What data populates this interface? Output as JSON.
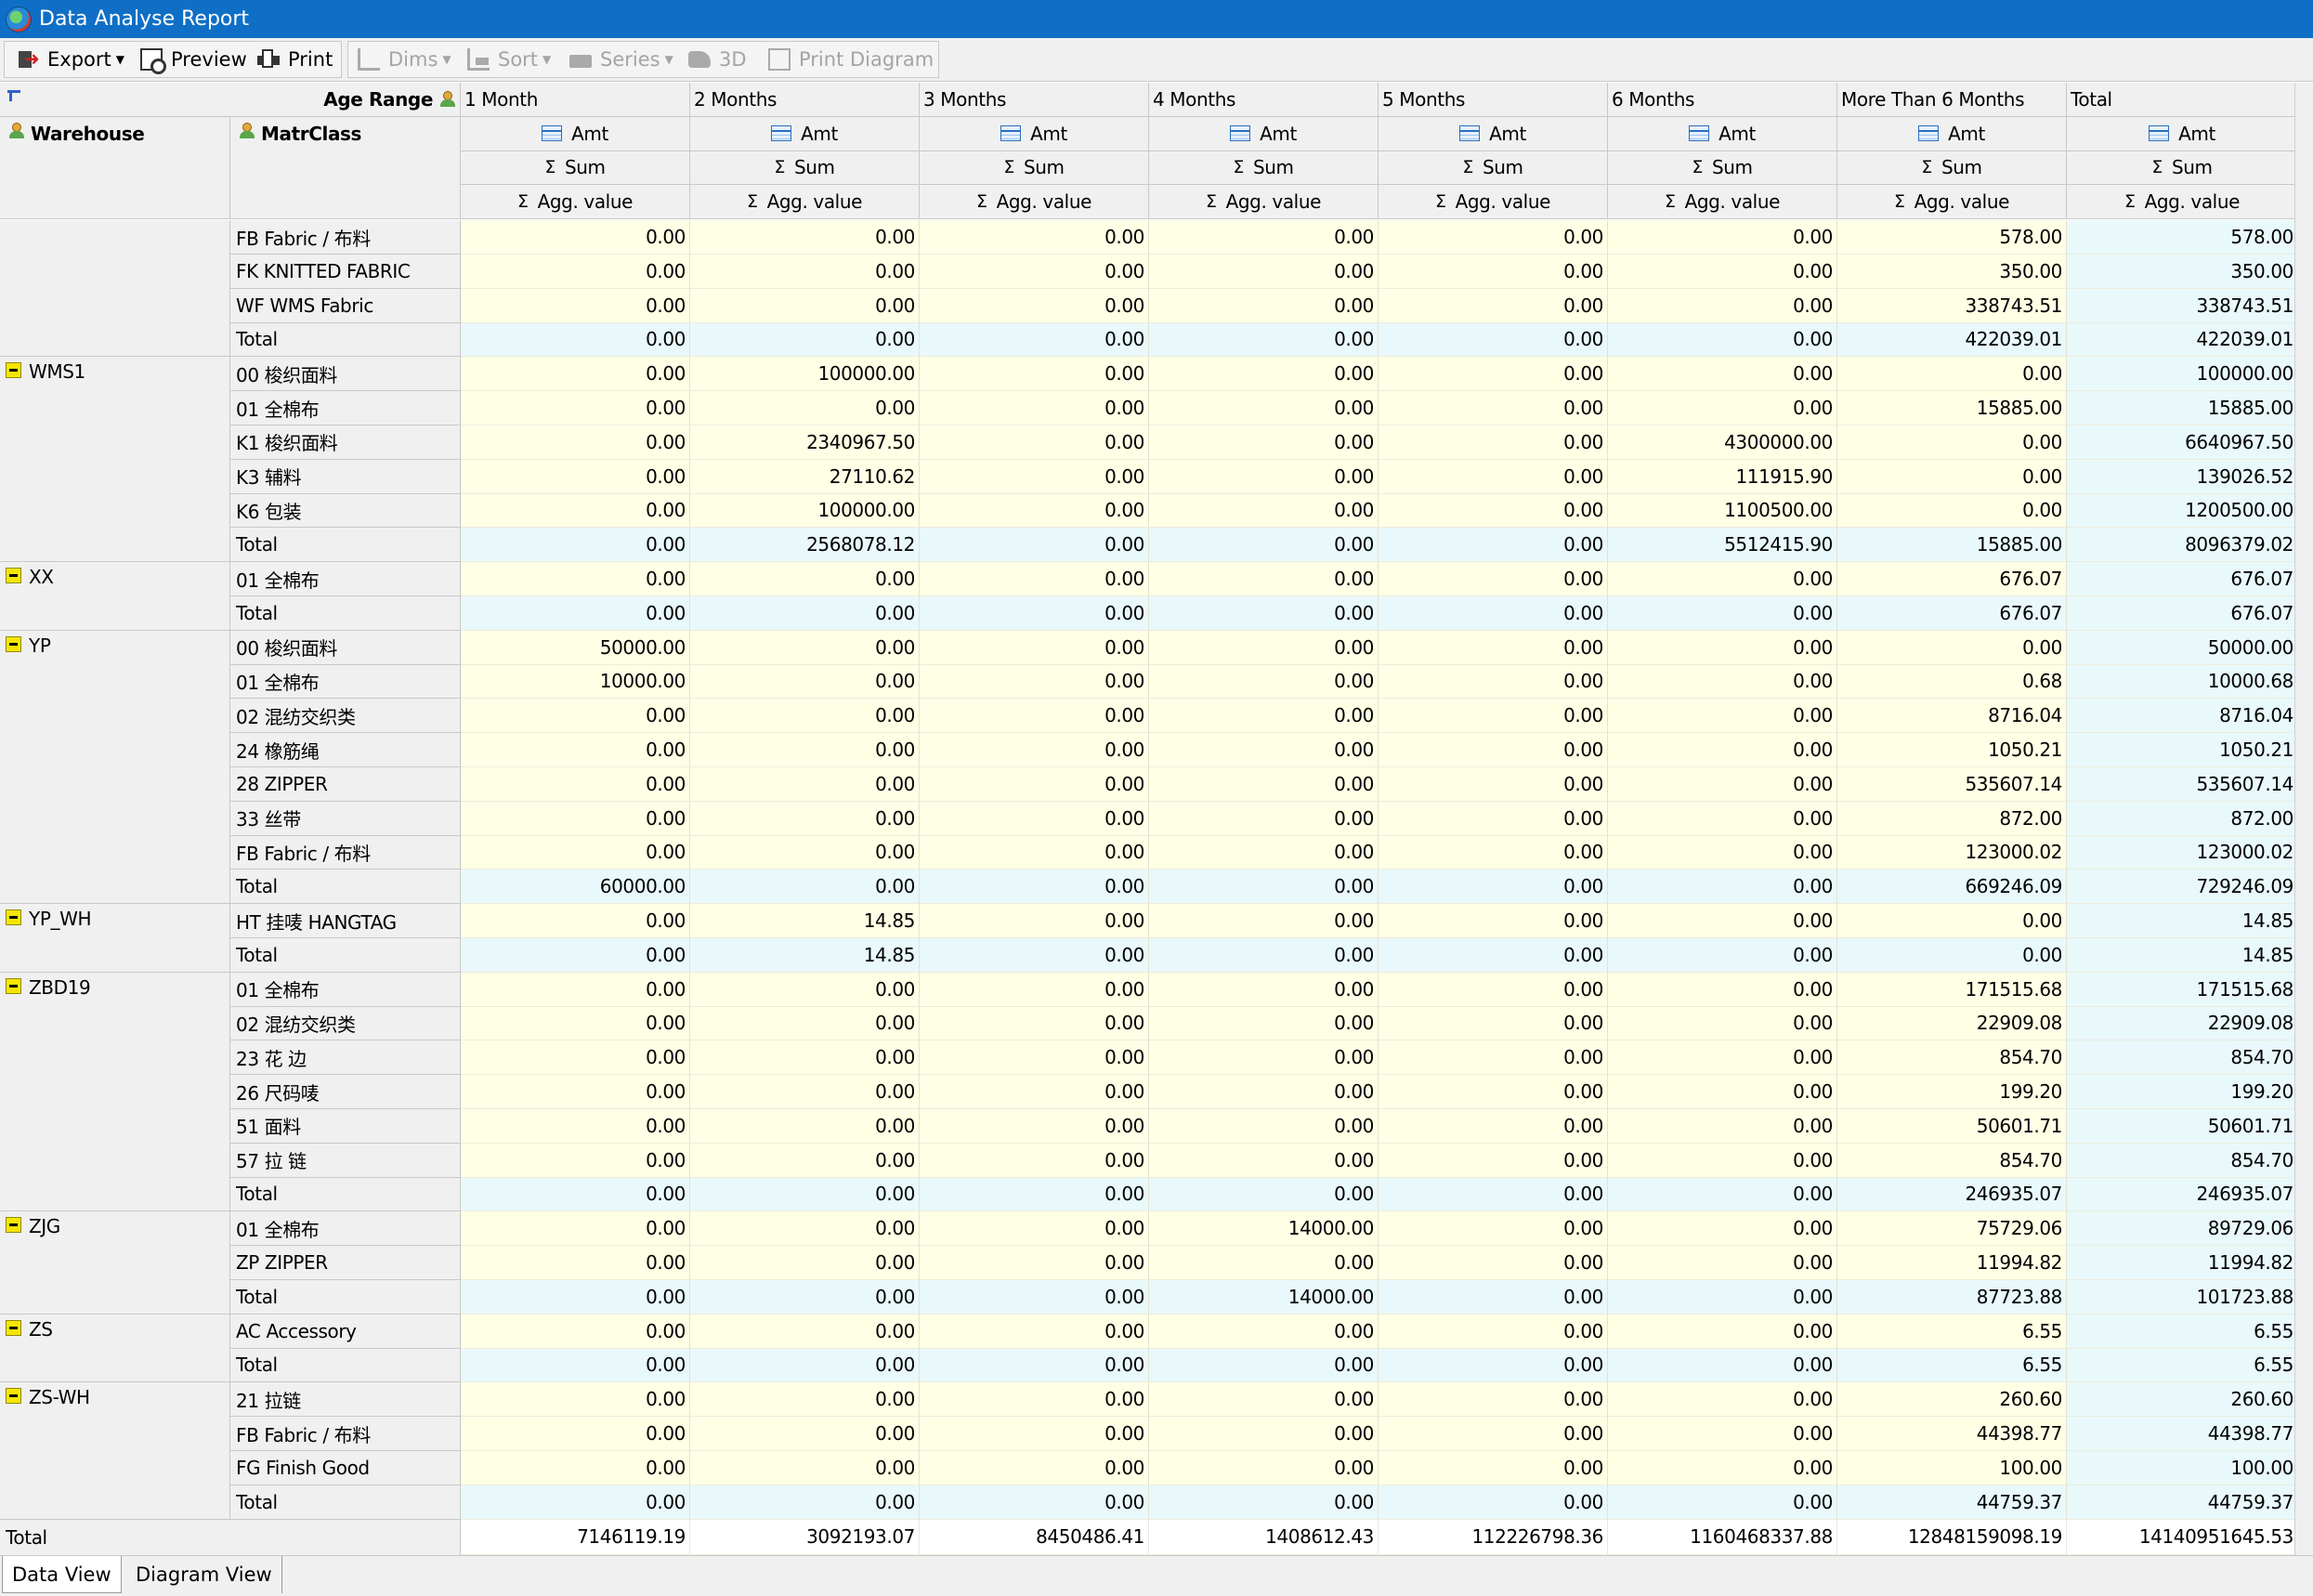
{
  "window": {
    "title": "Data Analyse Report"
  },
  "toolbar": {
    "export": "Export",
    "preview": "Preview",
    "print": "Print",
    "dims": "Dims",
    "sort": "Sort",
    "series": "Series",
    "three_d": "3D",
    "print_diagram": "Print Diagram"
  },
  "pivot": {
    "column_field": "Age Range",
    "row_fields": [
      "Warehouse",
      "MatrClass"
    ],
    "columns": [
      "1 Month",
      "2 Months",
      "3 Months",
      "4 Months",
      "5 Months",
      "6 Months",
      "More Than 6 Months",
      "Total"
    ],
    "measure": "Amt",
    "summary": "Sum",
    "agg_label": "Agg. value",
    "total_label": "Total",
    "groups": [
      {
        "warehouse": "",
        "collapsible": false,
        "rows": [
          {
            "label": "FB  Fabric / 布料",
            "values": [
              "0.00",
              "0.00",
              "0.00",
              "0.00",
              "0.00",
              "0.00",
              "578.00",
              "578.00"
            ]
          },
          {
            "label": "FK  KNITTED FABRIC",
            "values": [
              "0.00",
              "0.00",
              "0.00",
              "0.00",
              "0.00",
              "0.00",
              "350.00",
              "350.00"
            ]
          },
          {
            "label": "WF  WMS Fabric",
            "values": [
              "0.00",
              "0.00",
              "0.00",
              "0.00",
              "0.00",
              "0.00",
              "338743.51",
              "338743.51"
            ]
          },
          {
            "label": "Total",
            "total": true,
            "values": [
              "0.00",
              "0.00",
              "0.00",
              "0.00",
              "0.00",
              "0.00",
              "422039.01",
              "422039.01"
            ]
          }
        ]
      },
      {
        "warehouse": "WMS1",
        "collapsible": true,
        "rows": [
          {
            "label": "00  梭织面料",
            "values": [
              "0.00",
              "100000.00",
              "0.00",
              "0.00",
              "0.00",
              "0.00",
              "0.00",
              "100000.00"
            ]
          },
          {
            "label": "01  全棉布",
            "values": [
              "0.00",
              "0.00",
              "0.00",
              "0.00",
              "0.00",
              "0.00",
              "15885.00",
              "15885.00"
            ]
          },
          {
            "label": "K1  梭织面料",
            "values": [
              "0.00",
              "2340967.50",
              "0.00",
              "0.00",
              "0.00",
              "4300000.00",
              "0.00",
              "6640967.50"
            ]
          },
          {
            "label": "K3  辅料",
            "values": [
              "0.00",
              "27110.62",
              "0.00",
              "0.00",
              "0.00",
              "111915.90",
              "0.00",
              "139026.52"
            ]
          },
          {
            "label": "K6  包装",
            "values": [
              "0.00",
              "100000.00",
              "0.00",
              "0.00",
              "0.00",
              "1100500.00",
              "0.00",
              "1200500.00"
            ]
          },
          {
            "label": "Total",
            "total": true,
            "values": [
              "0.00",
              "2568078.12",
              "0.00",
              "0.00",
              "0.00",
              "5512415.90",
              "15885.00",
              "8096379.02"
            ]
          }
        ]
      },
      {
        "warehouse": "XX",
        "collapsible": true,
        "rows": [
          {
            "label": "01  全棉布",
            "values": [
              "0.00",
              "0.00",
              "0.00",
              "0.00",
              "0.00",
              "0.00",
              "676.07",
              "676.07"
            ]
          },
          {
            "label": "Total",
            "total": true,
            "values": [
              "0.00",
              "0.00",
              "0.00",
              "0.00",
              "0.00",
              "0.00",
              "676.07",
              "676.07"
            ]
          }
        ]
      },
      {
        "warehouse": "YP",
        "collapsible": true,
        "rows": [
          {
            "label": "00  梭织面料",
            "values": [
              "50000.00",
              "0.00",
              "0.00",
              "0.00",
              "0.00",
              "0.00",
              "0.00",
              "50000.00"
            ]
          },
          {
            "label": "01  全棉布",
            "values": [
              "10000.00",
              "0.00",
              "0.00",
              "0.00",
              "0.00",
              "0.00",
              "0.68",
              "10000.68"
            ]
          },
          {
            "label": "02  混纺交织类",
            "values": [
              "0.00",
              "0.00",
              "0.00",
              "0.00",
              "0.00",
              "0.00",
              "8716.04",
              "8716.04"
            ]
          },
          {
            "label": "24  橡筋绳",
            "values": [
              "0.00",
              "0.00",
              "0.00",
              "0.00",
              "0.00",
              "0.00",
              "1050.21",
              "1050.21"
            ]
          },
          {
            "label": "28  ZIPPER",
            "values": [
              "0.00",
              "0.00",
              "0.00",
              "0.00",
              "0.00",
              "0.00",
              "535607.14",
              "535607.14"
            ]
          },
          {
            "label": "33  丝带",
            "values": [
              "0.00",
              "0.00",
              "0.00",
              "0.00",
              "0.00",
              "0.00",
              "872.00",
              "872.00"
            ]
          },
          {
            "label": "FB  Fabric / 布料",
            "values": [
              "0.00",
              "0.00",
              "0.00",
              "0.00",
              "0.00",
              "0.00",
              "123000.02",
              "123000.02"
            ]
          },
          {
            "label": "Total",
            "total": true,
            "values": [
              "60000.00",
              "0.00",
              "0.00",
              "0.00",
              "0.00",
              "0.00",
              "669246.09",
              "729246.09"
            ]
          }
        ]
      },
      {
        "warehouse": "YP_WH",
        "collapsible": true,
        "rows": [
          {
            "label": "HT  挂唛 HANGTAG",
            "values": [
              "0.00",
              "14.85",
              "0.00",
              "0.00",
              "0.00",
              "0.00",
              "0.00",
              "14.85"
            ]
          },
          {
            "label": "Total",
            "total": true,
            "values": [
              "0.00",
              "14.85",
              "0.00",
              "0.00",
              "0.00",
              "0.00",
              "0.00",
              "14.85"
            ]
          }
        ]
      },
      {
        "warehouse": "ZBD19",
        "collapsible": true,
        "rows": [
          {
            "label": "01  全棉布",
            "values": [
              "0.00",
              "0.00",
              "0.00",
              "0.00",
              "0.00",
              "0.00",
              "171515.68",
              "171515.68"
            ]
          },
          {
            "label": "02  混纺交织类",
            "values": [
              "0.00",
              "0.00",
              "0.00",
              "0.00",
              "0.00",
              "0.00",
              "22909.08",
              "22909.08"
            ]
          },
          {
            "label": "23  花 边",
            "values": [
              "0.00",
              "0.00",
              "0.00",
              "0.00",
              "0.00",
              "0.00",
              "854.70",
              "854.70"
            ]
          },
          {
            "label": "26  尺码唛",
            "values": [
              "0.00",
              "0.00",
              "0.00",
              "0.00",
              "0.00",
              "0.00",
              "199.20",
              "199.20"
            ]
          },
          {
            "label": "51  面料",
            "values": [
              "0.00",
              "0.00",
              "0.00",
              "0.00",
              "0.00",
              "0.00",
              "50601.71",
              "50601.71"
            ]
          },
          {
            "label": "57  拉 链",
            "values": [
              "0.00",
              "0.00",
              "0.00",
              "0.00",
              "0.00",
              "0.00",
              "854.70",
              "854.70"
            ]
          },
          {
            "label": "Total",
            "total": true,
            "values": [
              "0.00",
              "0.00",
              "0.00",
              "0.00",
              "0.00",
              "0.00",
              "246935.07",
              "246935.07"
            ]
          }
        ]
      },
      {
        "warehouse": "ZJG",
        "collapsible": true,
        "rows": [
          {
            "label": "01  全棉布",
            "values": [
              "0.00",
              "0.00",
              "0.00",
              "14000.00",
              "0.00",
              "0.00",
              "75729.06",
              "89729.06"
            ]
          },
          {
            "label": "ZP  ZIPPER",
            "values": [
              "0.00",
              "0.00",
              "0.00",
              "0.00",
              "0.00",
              "0.00",
              "11994.82",
              "11994.82"
            ]
          },
          {
            "label": "Total",
            "total": true,
            "values": [
              "0.00",
              "0.00",
              "0.00",
              "14000.00",
              "0.00",
              "0.00",
              "87723.88",
              "101723.88"
            ]
          }
        ]
      },
      {
        "warehouse": "ZS",
        "collapsible": true,
        "rows": [
          {
            "label": "AC  Accessory",
            "values": [
              "0.00",
              "0.00",
              "0.00",
              "0.00",
              "0.00",
              "0.00",
              "6.55",
              "6.55"
            ]
          },
          {
            "label": "Total",
            "total": true,
            "values": [
              "0.00",
              "0.00",
              "0.00",
              "0.00",
              "0.00",
              "0.00",
              "6.55",
              "6.55"
            ]
          }
        ]
      },
      {
        "warehouse": "ZS-WH",
        "collapsible": true,
        "rows": [
          {
            "label": "21  拉链",
            "values": [
              "0.00",
              "0.00",
              "0.00",
              "0.00",
              "0.00",
              "0.00",
              "260.60",
              "260.60"
            ]
          },
          {
            "label": "FB  Fabric / 布料",
            "values": [
              "0.00",
              "0.00",
              "0.00",
              "0.00",
              "0.00",
              "0.00",
              "44398.77",
              "44398.77"
            ]
          },
          {
            "label": "FG  Finish Good",
            "values": [
              "0.00",
              "0.00",
              "0.00",
              "0.00",
              "0.00",
              "0.00",
              "100.00",
              "100.00"
            ]
          },
          {
            "label": "Total",
            "total": true,
            "values": [
              "0.00",
              "0.00",
              "0.00",
              "0.00",
              "0.00",
              "0.00",
              "44759.37",
              "44759.37"
            ]
          }
        ]
      }
    ],
    "grand_total": {
      "label": "Total",
      "values": [
        "7146119.19",
        "3092193.07",
        "8450486.41",
        "1408612.43",
        "112226798.36",
        "1160468337.88",
        "12848159098.19",
        "14140951645.53"
      ]
    }
  },
  "tabs": [
    "Data View",
    "Diagram View"
  ],
  "colors": {
    "titlebar": "#0f6fc6",
    "cell": "#ffffe6",
    "total_cell": "#e9f8fb",
    "collapse_button": "#f6e600"
  }
}
